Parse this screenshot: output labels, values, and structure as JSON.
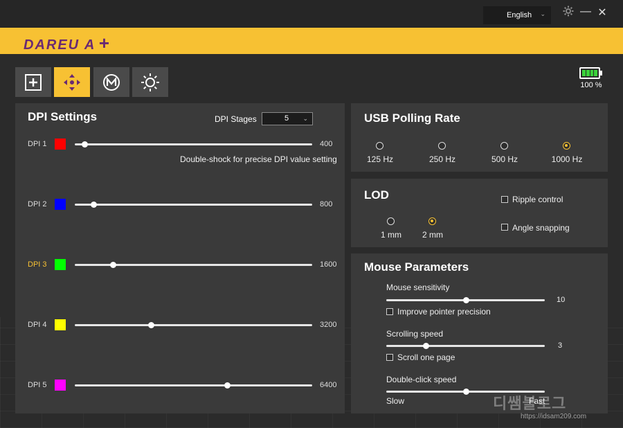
{
  "window": {
    "language": "English"
  },
  "brand": {
    "logo": "DAREU A",
    "logo_mark": "+"
  },
  "toolbar": {
    "tools": [
      {
        "icon": "plus-square-icon",
        "active": false
      },
      {
        "icon": "move-arrows-icon",
        "active": true
      },
      {
        "icon": "macro-m-icon",
        "active": false
      },
      {
        "icon": "lighting-sun-icon",
        "active": false
      }
    ]
  },
  "battery": {
    "percent_text": "100 %",
    "level": 1.0
  },
  "dpi": {
    "title": "DPI Settings",
    "stages_label": "DPI Stages",
    "stages_value": "5",
    "hint": "Double-shock for precise DPI value setting",
    "selected": "DPI 3",
    "max_dpi": 10000,
    "rows": [
      {
        "label": "DPI 1",
        "color": "#ff0000",
        "value": "400",
        "dpi": 400
      },
      {
        "label": "DPI 2",
        "color": "#0000ff",
        "value": "800",
        "dpi": 800
      },
      {
        "label": "DPI 3",
        "color": "#00ff00",
        "value": "1600",
        "dpi": 1600
      },
      {
        "label": "DPI 4",
        "color": "#ffff00",
        "value": "3200",
        "dpi": 3200
      },
      {
        "label": "DPI 5",
        "color": "#ff00ff",
        "value": "6400",
        "dpi": 6400
      }
    ]
  },
  "polling": {
    "title": "USB Polling Rate",
    "options": [
      "125 Hz",
      "250 Hz",
      "500 Hz",
      "1000 Hz"
    ],
    "selected": "1000 Hz"
  },
  "lod": {
    "title": "LOD",
    "options": [
      "1 mm",
      "2 mm"
    ],
    "selected": "2 mm",
    "ripple_label": "Ripple control",
    "ripple_checked": false,
    "angle_label": "Angle snapping",
    "angle_checked": false
  },
  "mouse": {
    "title": "Mouse Parameters",
    "sensitivity_label": "Mouse sensitivity",
    "sensitivity_value": "10",
    "sensitivity_level": 0.5,
    "precision_label": "Improve pointer precision",
    "precision_checked": false,
    "scroll_label": "Scrolling speed",
    "scroll_value": "3",
    "scroll_level": 0.25,
    "page_label": "Scroll one page",
    "page_checked": false,
    "dblclick_label": "Double-click speed",
    "dblclick_level": 0.5,
    "slow_label": "Slow",
    "fast_label": "Fast"
  },
  "watermark": {
    "text": "디쌤블로그",
    "url": "https://idsam209.com"
  },
  "colors": {
    "accent": "#f7c133",
    "panel": "#3a3a3a",
    "background": "#2b2b2b"
  }
}
